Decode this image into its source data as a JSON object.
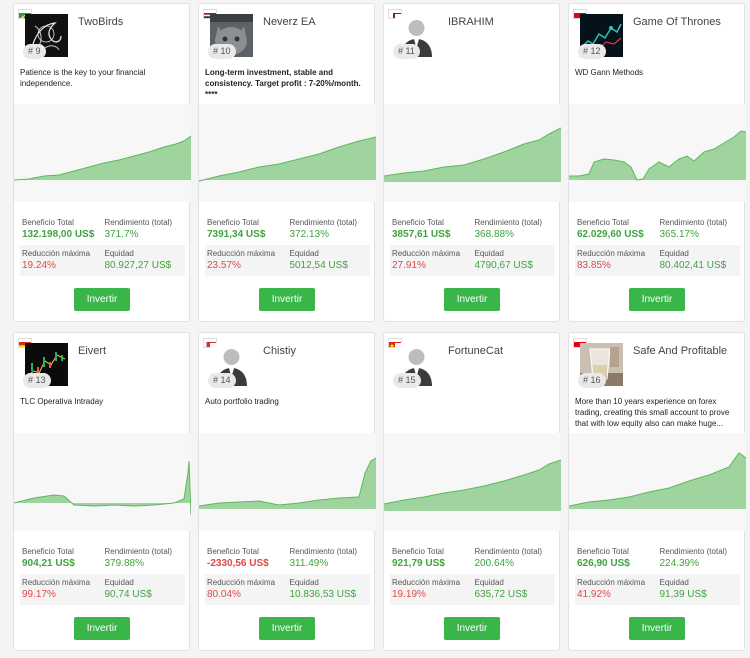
{
  "labels": {
    "profit": "Beneficio Total",
    "yield": "Rendimiento (total)",
    "drawdown": "Reducción máxima",
    "equity": "Equidad",
    "invest": "Invertir"
  },
  "colors": {
    "green": "#39b54a",
    "chart_fill": "#8fce8f",
    "chart_line": "#5cb85c",
    "red": "#e04848"
  },
  "cards": [
    {
      "name": "TwoBirds",
      "rank": "# 9",
      "flag": "flag-brazil",
      "avatar": "bird-drawing-avatar",
      "description": "Patience is the key to your financial independence.",
      "profit": "132.198,00 US$",
      "yield": "371.7%",
      "drawdown": "19.24%",
      "equity": "80.927,27 US$"
    },
    {
      "name": "Neverz EA",
      "rank": "# 10",
      "flag": "flag-thailand",
      "avatar": "cat-photo-avatar",
      "description": "Long-term investment, stable and consistency. Target profit : 7-20%/month. ****",
      "profit": "7391,34 US$",
      "yield": "372.13%",
      "drawdown": "23.57%",
      "equity": "5012,54 US$"
    },
    {
      "name": "IBRAHIM",
      "rank": "# 11",
      "flag": "flag-qatar",
      "avatar": "default-user-avatar",
      "description": "",
      "profit": "3857,61 US$",
      "yield": "368.88%",
      "drawdown": "27.91%",
      "equity": "4790,67 US$"
    },
    {
      "name": "Game Of Thrones",
      "rank": "# 12",
      "flag": "flag-indonesia",
      "avatar": "market-graph-avatar",
      "description": "WD Gann Methods",
      "profit": "62.029,60 US$",
      "yield": "365.17%",
      "drawdown": "83.85%",
      "equity": "80.402,41 US$"
    },
    {
      "name": "Eivert",
      "rank": "# 13",
      "flag": "flag-bolivia",
      "avatar": "trading-chart-avatar",
      "description": "TLC Operativa Intraday",
      "profit": "904,21 US$",
      "yield": "379.88%",
      "drawdown": "99.17%",
      "equity": "90,74 US$"
    },
    {
      "name": "Chistiy",
      "rank": "# 14",
      "flag": "flag-belarus",
      "avatar": "default-user-avatar",
      "description": "Auto portfolio trading",
      "profit": "-2330,56 US$",
      "yield": "311.49%",
      "drawdown": "80.04%",
      "equity": "10.836,53 US$"
    },
    {
      "name": "FortuneCat",
      "rank": "# 15",
      "flag": "flag-china",
      "avatar": "default-user-avatar",
      "description": "",
      "profit": "921,79 US$",
      "yield": "200.64%",
      "drawdown": "19.19%",
      "equity": "635,72 US$"
    },
    {
      "name": "Safe And Profitable",
      "rank": "# 16",
      "flag": "flag-indonesia",
      "avatar": "drink-photo-avatar",
      "description": "More than 10 years experience on forex trading, creating this small account to prove that with low equity also can make huge...",
      "profit": "626,90 US$",
      "yield": "224.39%",
      "drawdown": "41.92%",
      "equity": "91,39 US$"
    }
  ]
}
